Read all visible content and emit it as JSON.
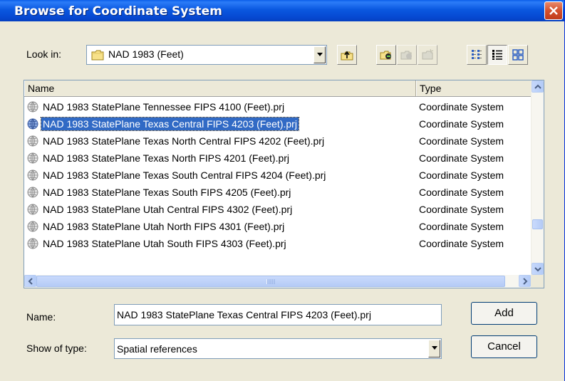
{
  "window": {
    "title": "Browse for Coordinate System"
  },
  "lookin": {
    "label": "Look in:",
    "value": "NAD 1983 (Feet)",
    "icon": "folder-icon"
  },
  "toolbar": {
    "buttons": [
      {
        "name": "up-one-level-icon",
        "enabled": true
      },
      {
        "name": "connect-folder-icon",
        "enabled": true
      },
      {
        "name": "disconnect-folder-icon",
        "enabled": false
      },
      {
        "name": "new-item-icon",
        "enabled": false
      },
      {
        "name": "list-view-icon",
        "enabled": true
      },
      {
        "name": "details-view-icon",
        "enabled": true,
        "pressed": true
      },
      {
        "name": "thumbnails-view-icon",
        "enabled": true
      }
    ]
  },
  "list": {
    "columns": [
      "Name",
      "Type"
    ],
    "rows": [
      {
        "name": "NAD 1983 StatePlane Tennessee FIPS 4100 (Feet).prj",
        "type": "Coordinate System",
        "selected": false
      },
      {
        "name": "NAD 1983 StatePlane Texas Central FIPS 4203 (Feet).prj",
        "type": "Coordinate System",
        "selected": true
      },
      {
        "name": "NAD 1983 StatePlane Texas North Central FIPS 4202 (Feet).prj",
        "type": "Coordinate System",
        "selected": false
      },
      {
        "name": "NAD 1983 StatePlane Texas North FIPS 4201 (Feet).prj",
        "type": "Coordinate System",
        "selected": false
      },
      {
        "name": "NAD 1983 StatePlane Texas South Central FIPS 4204 (Feet).prj",
        "type": "Coordinate System",
        "selected": false
      },
      {
        "name": "NAD 1983 StatePlane Texas South FIPS 4205 (Feet).prj",
        "type": "Coordinate System",
        "selected": false
      },
      {
        "name": "NAD 1983 StatePlane Utah Central FIPS 4302 (Feet).prj",
        "type": "Coordinate System",
        "selected": false
      },
      {
        "name": "NAD 1983 StatePlane Utah North FIPS 4301 (Feet).prj",
        "type": "Coordinate System",
        "selected": false
      },
      {
        "name": "NAD 1983 StatePlane Utah South FIPS 4303 (Feet).prj",
        "type": "Coordinate System",
        "selected": false
      }
    ]
  },
  "form": {
    "name_label": "Name:",
    "name_value": "NAD 1983 StatePlane Texas Central FIPS 4203 (Feet).prj",
    "type_label": "Show of type:",
    "type_value": "Spatial references"
  },
  "buttons": {
    "add": "Add",
    "cancel": "Cancel"
  },
  "colors": {
    "titlebar": "#0a58e0",
    "selection": "#316ac5",
    "face": "#ece9d8"
  }
}
